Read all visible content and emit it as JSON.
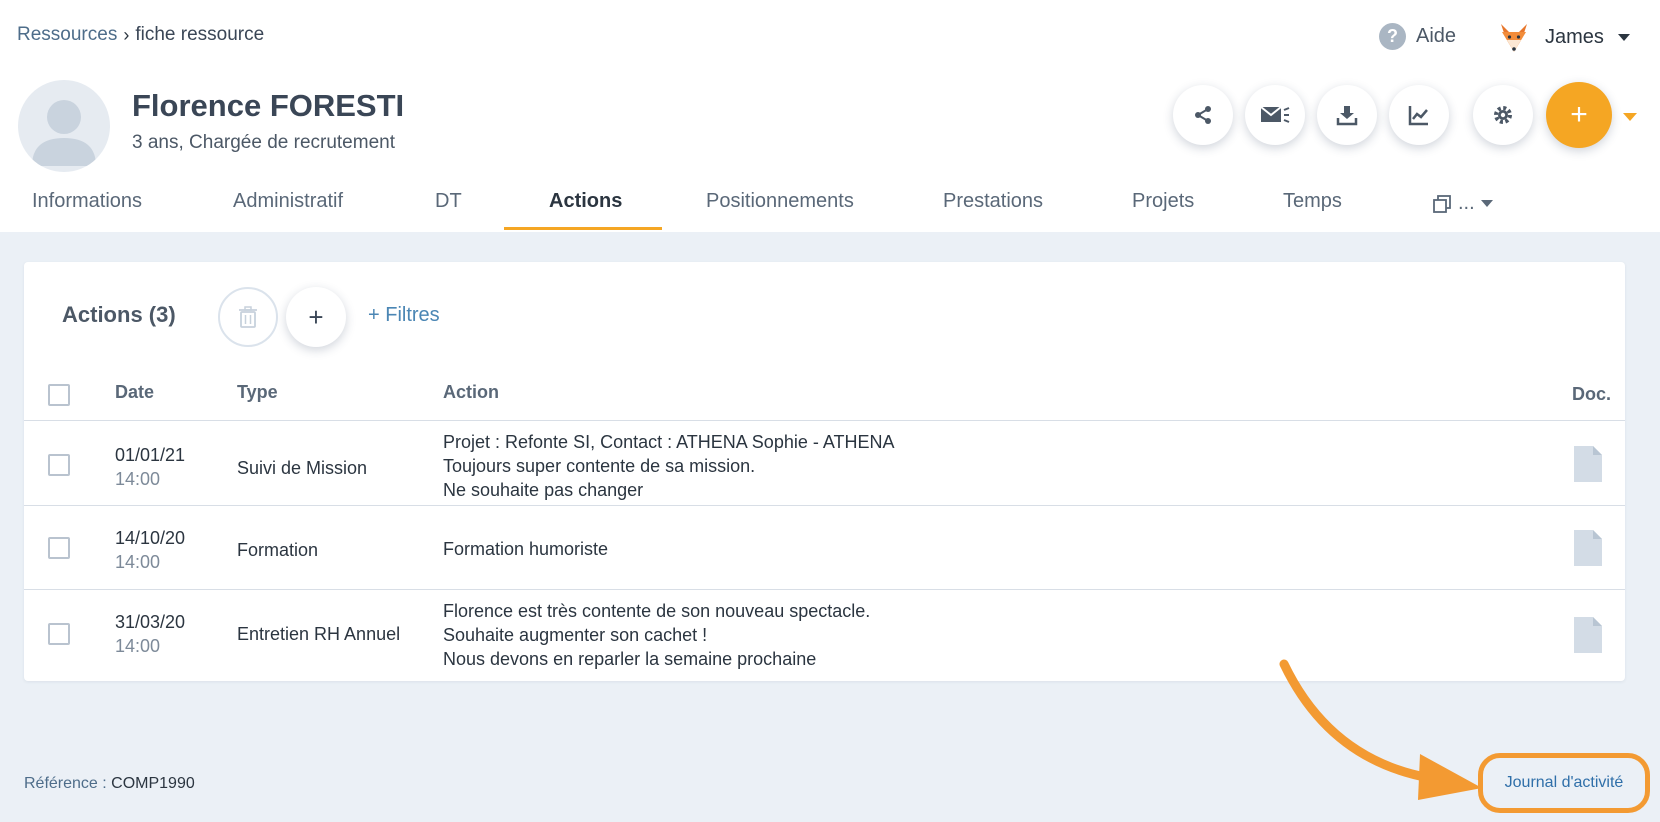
{
  "breadcrumb": {
    "parent": "Ressources",
    "separator": "›",
    "current": "fiche ressource"
  },
  "header": {
    "help_label": "Aide",
    "user_name": "James"
  },
  "profile": {
    "name": "Florence FORESTI",
    "subtitle": "3 ans, Chargée de recrutement"
  },
  "toolbar": {
    "icons": [
      "share-icon",
      "mail-icon",
      "download-icon",
      "chart-icon",
      "gear-icon"
    ],
    "fab_label": "+",
    "accent_color": "#f5a623"
  },
  "tabs": [
    {
      "label": "Informations"
    },
    {
      "label": "Administratif"
    },
    {
      "label": "DT"
    },
    {
      "label": "Actions",
      "active": true
    },
    {
      "label": "Positionnements"
    },
    {
      "label": "Prestations"
    },
    {
      "label": "Projets"
    },
    {
      "label": "Temps"
    },
    {
      "label": "..."
    }
  ],
  "actions_card": {
    "title": "Actions (3)",
    "add_label": "+",
    "filters_label": "+ Filtres",
    "columns": {
      "date": "Date",
      "type": "Type",
      "action": "Action",
      "doc": "Doc."
    },
    "rows": [
      {
        "date": "01/01/21",
        "time": "14:00",
        "type": "Suivi de Mission",
        "lines": [
          "Projet : Refonte SI, Contact : ATHENA Sophie - ATHENA",
          "Toujours super contente de sa mission.",
          "Ne souhaite pas changer"
        ]
      },
      {
        "date": "14/10/20",
        "time": "14:00",
        "type": "Formation",
        "lines": [
          "Formation humoriste"
        ]
      },
      {
        "date": "31/03/20",
        "time": "14:00",
        "type": "Entretien RH Annuel",
        "lines": [
          "Florence est très contente de son nouveau spectacle.",
          "Souhaite augmenter son cachet !",
          "Nous devons en reparler la semaine prochaine"
        ]
      }
    ]
  },
  "footer": {
    "reference_label": "Référence : ",
    "reference_value": "COMP1990",
    "journal_link": "Journal d'activité"
  }
}
